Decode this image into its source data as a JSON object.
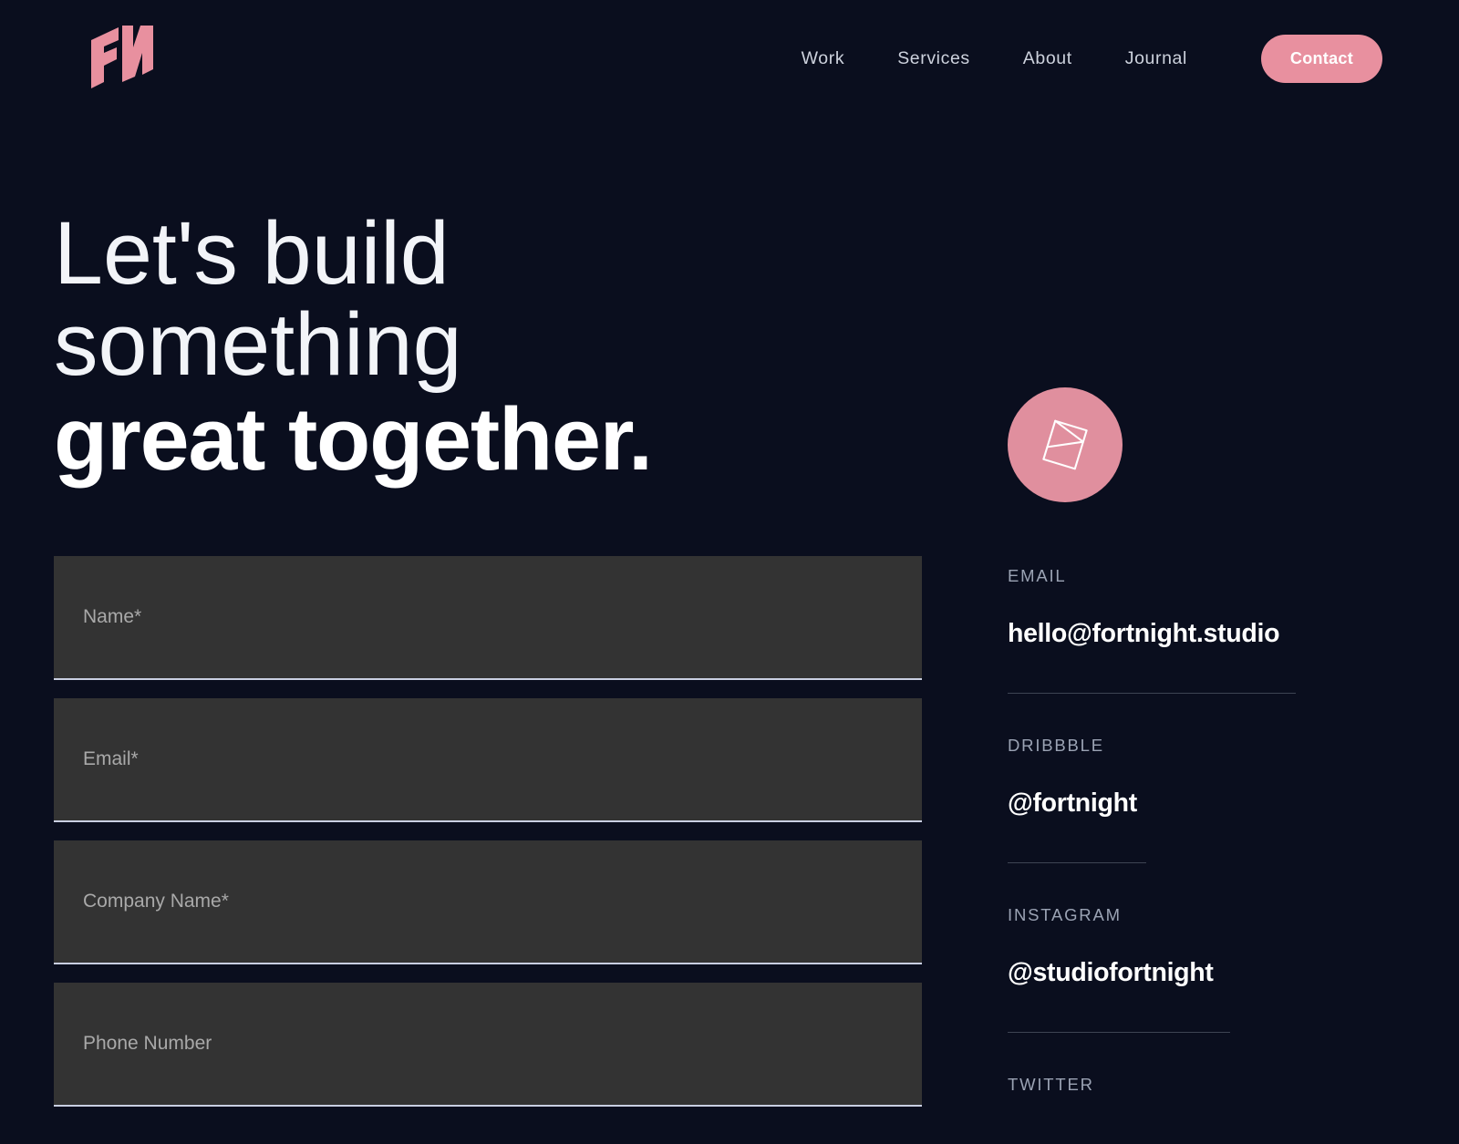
{
  "brand": {
    "logo_text": "FN",
    "logo_icon": "fn-monogram-logo",
    "accent_color": "#e8909f",
    "background_color": "#0a0e1e"
  },
  "nav": {
    "items": [
      {
        "label": "Work"
      },
      {
        "label": "Services"
      },
      {
        "label": "About"
      },
      {
        "label": "Journal"
      }
    ],
    "cta": {
      "label": "Contact"
    }
  },
  "hero": {
    "line1": "Let's build",
    "line2": "something",
    "line3": "great together."
  },
  "form": {
    "fields": [
      {
        "name": "name",
        "placeholder": "Name*",
        "value": ""
      },
      {
        "name": "email",
        "placeholder": "Email*",
        "value": ""
      },
      {
        "name": "company",
        "placeholder": "Company Name*",
        "value": ""
      },
      {
        "name": "phone",
        "placeholder": "Phone Number",
        "value": ""
      }
    ]
  },
  "contact": {
    "badge_icon": "envelope-icon",
    "items": [
      {
        "label": "EMAIL",
        "value": "hello@fortnight.studio"
      },
      {
        "label": "DRIBBBLE",
        "value": "@fortnight"
      },
      {
        "label": "INSTAGRAM",
        "value": "@studiofortnight"
      },
      {
        "label": "TWITTER",
        "value": ""
      }
    ]
  }
}
